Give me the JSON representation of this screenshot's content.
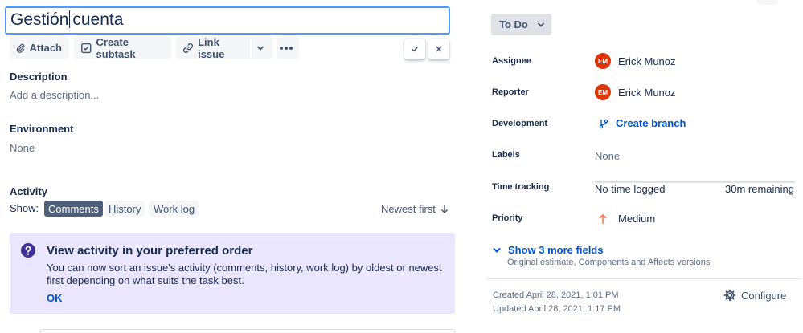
{
  "summary": {
    "text_before_caret": "Gestión",
    "text_after_caret": "cuenta"
  },
  "toolbar": {
    "attach_label": "Attach",
    "create_subtask_label": "Create subtask",
    "link_issue_label": "Link issue"
  },
  "description": {
    "label": "Description",
    "placeholder": "Add a description..."
  },
  "environment": {
    "label": "Environment",
    "value": "None"
  },
  "activity": {
    "label": "Activity",
    "show_label": "Show:",
    "tabs": [
      {
        "label": "Comments",
        "active": true
      },
      {
        "label": "History",
        "active": false
      },
      {
        "label": "Work log",
        "active": false
      }
    ],
    "sort_label": "Newest first"
  },
  "notice": {
    "title": "View activity in your preferred order",
    "body": "You can now sort an issue's activity (comments, history, work log) by oldest or newest first depending on what suits the task best.",
    "ok_label": "OK"
  },
  "status": {
    "label": "To Do"
  },
  "fields": {
    "assignee": {
      "label": "Assignee",
      "initials": "EM",
      "name": "Erick Munoz"
    },
    "reporter": {
      "label": "Reporter",
      "initials": "EM",
      "name": "Erick Munoz"
    },
    "development": {
      "label": "Development",
      "value": "Create branch"
    },
    "labels": {
      "label": "Labels",
      "value": "None"
    },
    "time_tracking": {
      "label": "Time tracking",
      "logged": "No time logged",
      "remaining": "30m remaining"
    },
    "priority": {
      "label": "Priority",
      "value": "Medium"
    }
  },
  "more_fields": {
    "label": "Show 3 more fields",
    "sub": "Original estimate, Components and Affects versions"
  },
  "meta": {
    "created": "Created April 28, 2021, 1:01 PM",
    "updated": "Updated April 28, 2021, 1:17 PM",
    "configure_label": "Configure"
  },
  "colors": {
    "accent": "#0052cc",
    "focus_border": "#4c9aff",
    "avatar_bg": "#de350b",
    "notice_bg": "#eae6ff",
    "priority_medium": "#ff7452"
  },
  "icons": [
    "paperclip-icon",
    "subtask-icon",
    "link-icon",
    "chevron-down-icon",
    "more-icon",
    "check-icon",
    "close-icon",
    "question-icon",
    "arrow-down-icon",
    "branch-icon",
    "arrow-up-icon",
    "gear-icon"
  ]
}
